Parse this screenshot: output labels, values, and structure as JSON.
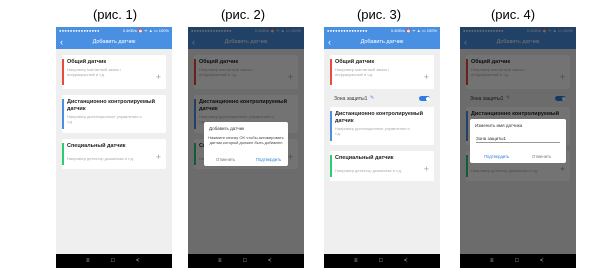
{
  "captions": [
    "(рис. 1)",
    "(рис. 2)",
    "(рис. 3)",
    "(рис. 4)"
  ],
  "status_bar": {
    "left": "●●●●●●●●●●●●●●●",
    "right": "0.4KB/s ⏰ ᯤ ▲ ▭ 100%"
  },
  "app_title": "Добавить датчик",
  "back_icon": "chevron-left-icon",
  "cards": [
    {
      "title": "Общий датчик",
      "desc": "Например магнитный замок / инфракрасный и т.д.",
      "color": "#e74c3c"
    },
    {
      "title": "Дистанционно контролируемый датчик",
      "desc": "Например дистанционное управление и т.д.",
      "color": "#4a90e2"
    },
    {
      "title": "Специальный датчик",
      "desc": "Например детектор дыма/газа и т.д.",
      "color": "#2ecc71"
    }
  ],
  "zone_label": "Зона защиты1",
  "dialog2": {
    "title": "Добавить датчик",
    "message": "Нажмите кнопку OK чтобы активировать датчик,который должен быть добавлен",
    "cancel": "Отменить",
    "confirm": "Подтвердить"
  },
  "dialog4": {
    "title": "Изменить имя датчика",
    "input_value": "Зона защиты1",
    "confirm": "Подтвердить",
    "cancel": "Отменить"
  },
  "nav": {
    "menu": "≡",
    "home": "□",
    "back": "<"
  }
}
